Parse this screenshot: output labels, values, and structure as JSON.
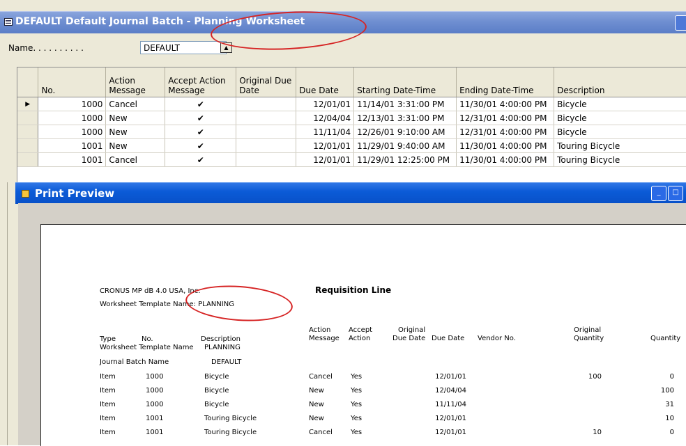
{
  "window": {
    "title": "DEFAULT Default Journal Batch - Planning Worksheet"
  },
  "name_field": {
    "label": "Name. . . . . . . . . .",
    "value": "DEFAULT"
  },
  "grid": {
    "headers": [
      "No.",
      "Action Message",
      "Accept Action Message",
      "Original Due Date",
      "Due Date",
      "Starting Date-Time",
      "Ending Date-Time",
      "Description"
    ],
    "rows": [
      {
        "selector": "▶",
        "no": "1000",
        "action": "Cancel",
        "accept": "✔",
        "orig_due": "",
        "due": "12/01/01",
        "start": "11/14/01 3:31:00 PM",
        "end": "11/30/01 4:00:00 PM",
        "desc": "Bicycle"
      },
      {
        "selector": "",
        "no": "1000",
        "action": "New",
        "accept": "✔",
        "orig_due": "",
        "due": "12/04/04",
        "start": "12/13/01 3:31:00 PM",
        "end": "12/31/01 4:00:00 PM",
        "desc": "Bicycle"
      },
      {
        "selector": "",
        "no": "1000",
        "action": "New",
        "accept": "✔",
        "orig_due": "",
        "due": "11/11/04",
        "start": "12/26/01 9:10:00 AM",
        "end": "12/31/01 4:00:00 PM",
        "desc": "Bicycle"
      },
      {
        "selector": "",
        "no": "1001",
        "action": "New",
        "accept": "✔",
        "orig_due": "",
        "due": "12/01/01",
        "start": "11/29/01 9:40:00 AM",
        "end": "11/30/01 4:00:00 PM",
        "desc": "Touring Bicycle"
      },
      {
        "selector": "",
        "no": "1001",
        "action": "Cancel",
        "accept": "✔",
        "orig_due": "",
        "due": "12/01/01",
        "start": "11/29/01 12:25:00 PM",
        "end": "11/30/01 4:00:00 PM",
        "desc": "Touring Bicycle"
      }
    ]
  },
  "print_preview": {
    "title": "Print Preview",
    "report": {
      "company": "CRONUS MP dB 4.0 USA, Inc.",
      "report_title": "Requisition Line",
      "filter_line": "Worksheet Template Name: PLANNING",
      "col_type": "Type",
      "col_no": "No.",
      "col_desc": "Description",
      "col_action_1": "Action",
      "col_action_2": "Message",
      "col_accept_1": "Accept",
      "col_accept_2": "Action",
      "col_orig_1": "Original",
      "col_orig_2": "Due Date",
      "col_due": "Due Date",
      "col_vendor": "Vendor No.",
      "col_origqty_1": "Original",
      "col_origqty_2": "Quantity",
      "col_qty": "Quantity",
      "group1_label": "Worksheet Template Name",
      "group1_value": "PLANNING",
      "group2_label": "Journal Batch Name",
      "group2_value": "DEFAULT",
      "lines": [
        {
          "type": "Item",
          "no": "1000",
          "desc": "Bicycle",
          "action": "Cancel",
          "accept": "Yes",
          "due": "12/01/01",
          "origqty": "100",
          "qty": "0"
        },
        {
          "type": "Item",
          "no": "1000",
          "desc": "Bicycle",
          "action": "New",
          "accept": "Yes",
          "due": "12/04/04",
          "origqty": "",
          "qty": "100"
        },
        {
          "type": "Item",
          "no": "1000",
          "desc": "Bicycle",
          "action": "New",
          "accept": "Yes",
          "due": "11/11/04",
          "origqty": "",
          "qty": "31"
        },
        {
          "type": "Item",
          "no": "1001",
          "desc": "Touring Bicycle",
          "action": "New",
          "accept": "Yes",
          "due": "12/01/01",
          "origqty": "",
          "qty": "10"
        },
        {
          "type": "Item",
          "no": "1001",
          "desc": "Touring Bicycle",
          "action": "Cancel",
          "accept": "Yes",
          "due": "12/01/01",
          "origqty": "10",
          "qty": "0"
        }
      ]
    }
  },
  "icons": {
    "window": "worksheet-icon",
    "lookup": "lookup-arrow-icon",
    "print_preview": "print-preview-icon"
  },
  "colors": {
    "xp_blue_title": "#0b5bd7",
    "inactive_title": "#6f8fd1",
    "annotation_red": "#d62424",
    "window_face": "#ece9d8"
  }
}
